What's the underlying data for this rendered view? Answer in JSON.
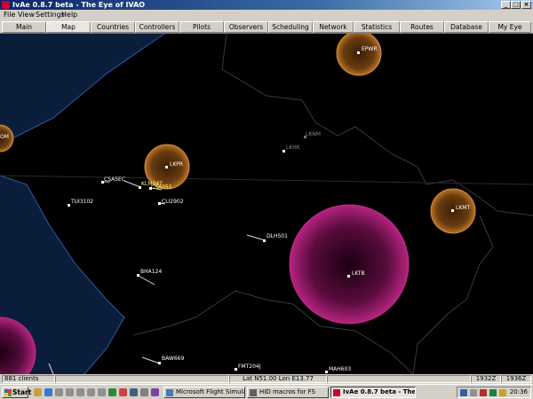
{
  "window": {
    "title": "IvAe 0.8.7 beta - The Eye of IVAO"
  },
  "menu": [
    "File",
    "View",
    "Settings",
    "Help"
  ],
  "tabs": [
    "Main",
    "Map",
    "Countries",
    "Controllers",
    "Pilots",
    "Observers",
    "Scheduling",
    "Network",
    "Statistics",
    "Routes",
    "Database",
    "My Eye"
  ],
  "active_tab": "Map",
  "map": {
    "colors": {
      "sea": "#0a1e3c",
      "border": "#2a5aa8",
      "land_border": "#3a3a3a",
      "atc_ring": "#d08a3a",
      "approach_ring": "#c22a8a"
    },
    "airports": [
      "EPWR",
      "LKPR",
      "LKMT",
      "LKTB",
      "LKNM",
      "LKHK",
      "OM"
    ],
    "aircraft": [
      "CSA5EC",
      "KLM04T",
      "CSA051",
      "CLI2902",
      "TUI3102",
      "DLH501",
      "BHA124",
      "BAW669",
      "FMT204J",
      "MAH603"
    ]
  },
  "status": {
    "clients": "881 clients",
    "position": "Lat N51.00 Lon E13.77",
    "time_utc": "1932Z",
    "time_local": "1936Z"
  },
  "taskbar": {
    "start": "Start",
    "buttons": [
      "Microsoft Flight Simulator...",
      "HID macros for FS",
      "IvAe 0.8.7 beta - The ..."
    ],
    "clock": "20:36"
  }
}
